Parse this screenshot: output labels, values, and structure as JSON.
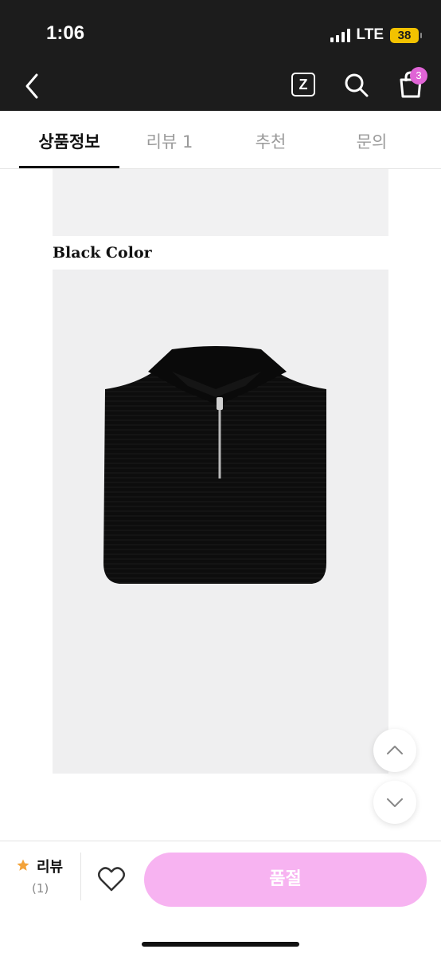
{
  "status_bar": {
    "time": "1:06",
    "network": "LTE",
    "battery": "38"
  },
  "header": {
    "bag_count": "3"
  },
  "tabs": [
    {
      "label": "상품정보",
      "active": true
    },
    {
      "label": "리뷰 1",
      "active": false
    },
    {
      "label": "추천",
      "active": false
    },
    {
      "label": "문의",
      "active": false
    }
  ],
  "content": {
    "color_caption": "Black Color"
  },
  "bottom_bar": {
    "review_label": "리뷰",
    "review_count": "(1)",
    "soldout_label": "품절"
  },
  "colors": {
    "accent": "#e064d6",
    "soldout_button": "#f7b3f1",
    "star": "#f3a33a",
    "header_bg": "#1c1c1c"
  },
  "icons": [
    "chevron-left-icon",
    "z-icon",
    "search-icon",
    "shopping-bag-icon",
    "chevron-up-icon",
    "chevron-down-icon",
    "star-icon",
    "heart-icon"
  ]
}
